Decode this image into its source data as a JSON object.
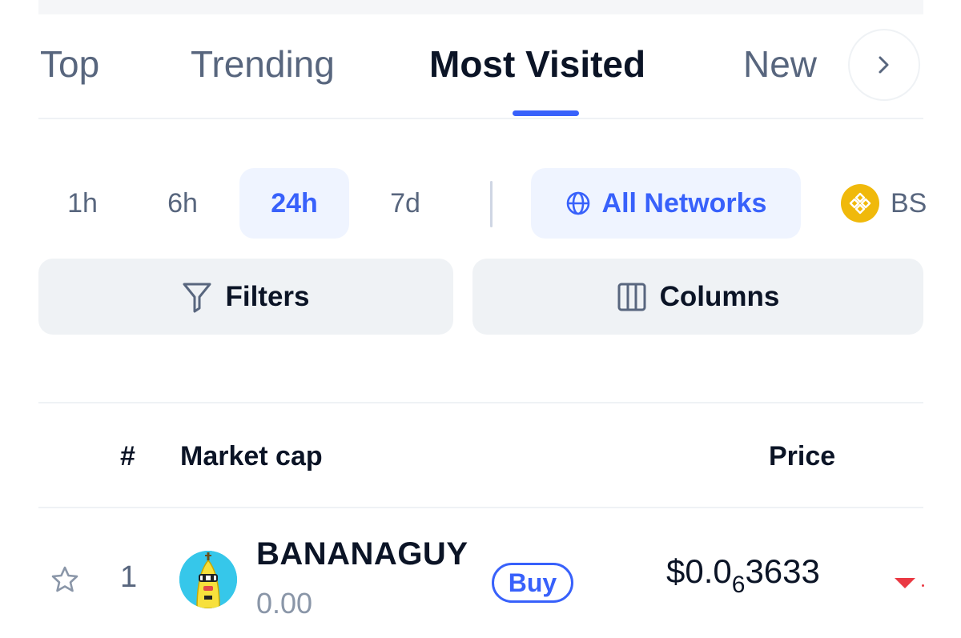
{
  "tabs": [
    {
      "label": "Top",
      "active": false
    },
    {
      "label": "Trending",
      "active": false
    },
    {
      "label": "Most Visited",
      "active": true
    },
    {
      "label": "New",
      "active": false
    }
  ],
  "time_ranges": [
    {
      "label": "1h",
      "active": false
    },
    {
      "label": "6h",
      "active": false
    },
    {
      "label": "24h",
      "active": true
    },
    {
      "label": "7d",
      "active": false
    }
  ],
  "networks": {
    "all_label": "All Networks",
    "bsc_label": "BS"
  },
  "actions": {
    "filters_label": "Filters",
    "columns_label": "Columns"
  },
  "table": {
    "headers": {
      "rank": "#",
      "market_cap": "Market cap",
      "price": "Price"
    },
    "rows": [
      {
        "rank": "1",
        "name": "BANANAGUY",
        "market_cap": "0.00",
        "buy_label": "Buy",
        "price_prefix": "$0.0",
        "price_zero_count": "6",
        "price_digits": "3633",
        "change_direction": "down"
      }
    ]
  },
  "colors": {
    "accent": "#3861fb",
    "text_primary": "#0b1426",
    "text_secondary": "#58667e",
    "negative": "#ea3943",
    "bnb": "#f0b90b"
  }
}
